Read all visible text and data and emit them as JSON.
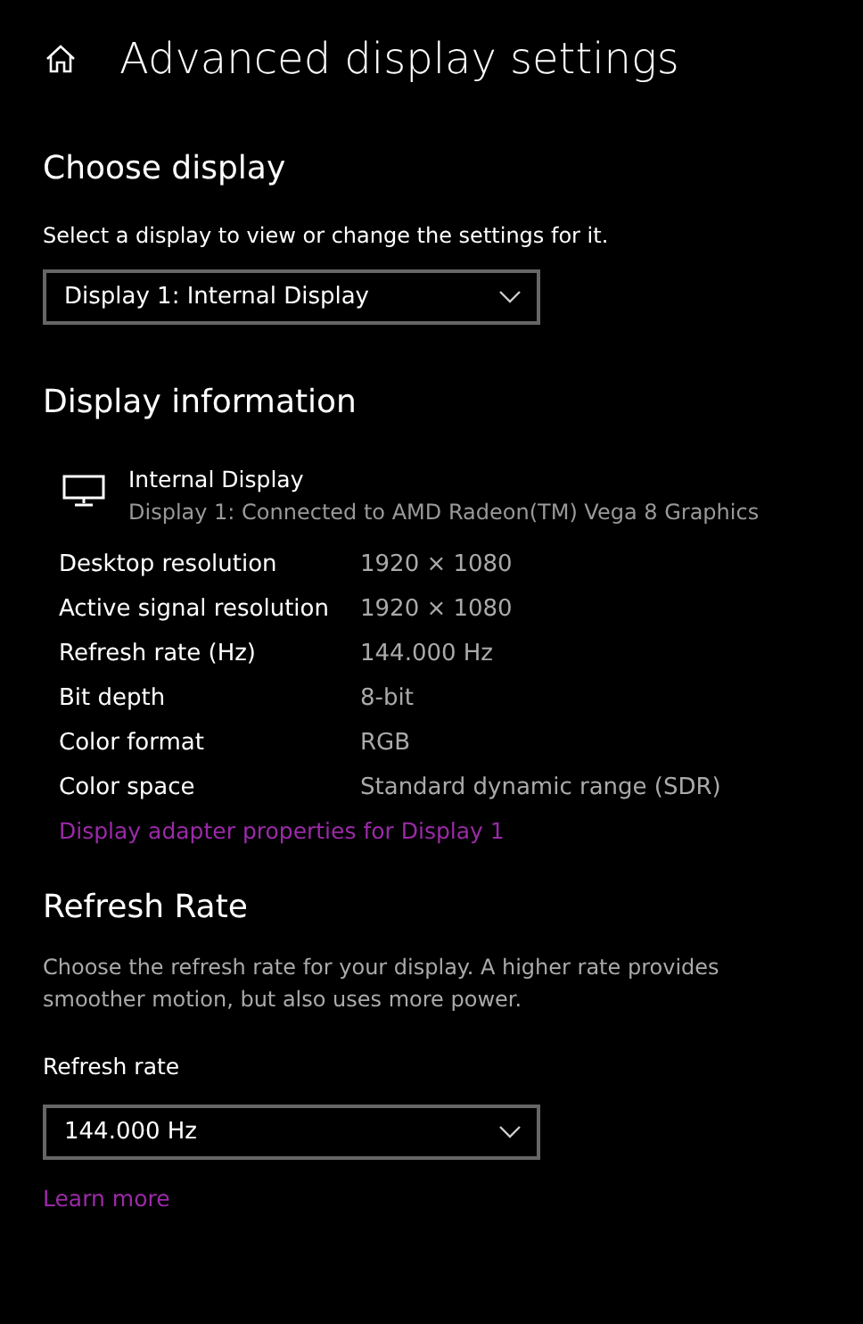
{
  "header": {
    "title": "Advanced display settings"
  },
  "choose_display": {
    "heading": "Choose display",
    "description": "Select a display to view or change the settings for it.",
    "dropdown": {
      "value": "Display 1: Internal Display"
    }
  },
  "display_information": {
    "heading": "Display information",
    "display_name": "Internal Display",
    "display_detail": "Display 1: Connected to AMD Radeon(TM) Vega 8 Graphics",
    "rows": [
      {
        "label": "Desktop resolution",
        "value": "1920 × 1080"
      },
      {
        "label": "Active signal resolution",
        "value": "1920 × 1080"
      },
      {
        "label": "Refresh rate (Hz)",
        "value": "144.000 Hz"
      },
      {
        "label": "Bit depth",
        "value": "8-bit"
      },
      {
        "label": "Color format",
        "value": "RGB"
      },
      {
        "label": "Color space",
        "value": "Standard dynamic range (SDR)"
      }
    ],
    "link": "Display adapter properties for Display 1"
  },
  "refresh_rate": {
    "heading": "Refresh Rate",
    "description": "Choose the refresh rate for your display. A higher rate provides smoother motion, but also uses more power.",
    "label": "Refresh rate",
    "dropdown": {
      "value": "144.000 Hz"
    },
    "link": "Learn more"
  }
}
